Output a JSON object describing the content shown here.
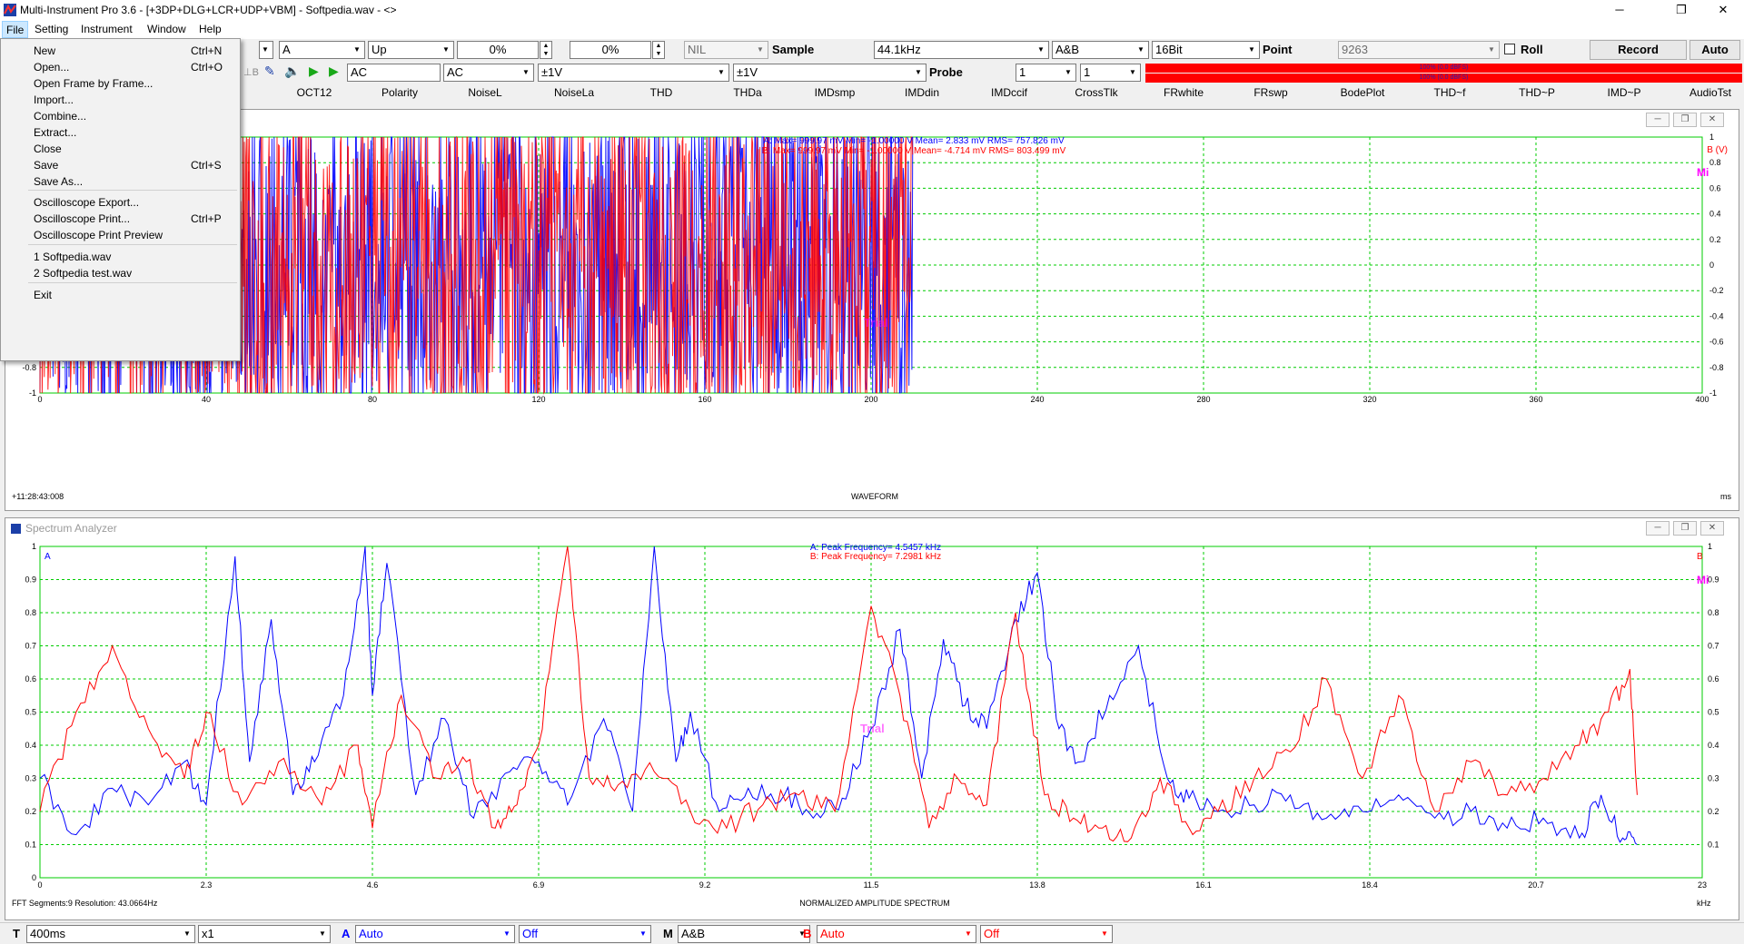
{
  "window": {
    "title": "Multi-Instrument Pro 3.6  -  [+3DP+DLG+LCR+UDP+VBM]  -  Softpedia.wav  -  <>"
  },
  "menubar": [
    "File",
    "Setting",
    "Instrument",
    "Window",
    "Help"
  ],
  "toolbar1": {
    "c1": "A",
    "c2": "Up",
    "trig_pct1": "0%",
    "trig_pct2": "0%",
    "nil": "NIL",
    "sample_label": "Sample",
    "sample": "44.1kHz",
    "channels": "A&B",
    "bits": "16Bit",
    "point_label": "Point",
    "point": "9263",
    "roll": "Roll",
    "record": "Record",
    "auto": "Auto"
  },
  "toolbar2": {
    "coupling_a": "AC",
    "coupling_b": "AC",
    "range_a": "±1V",
    "range_b": "±1V",
    "probe_label": "Probe",
    "probe_a": "1",
    "probe_b": "1",
    "level1": "100% (0.0 dBFS)",
    "level2": "100% (0.0 dBFS)"
  },
  "tabs": [
    "OCT12",
    "Polarity",
    "NoiseL",
    "NoiseLa",
    "THD",
    "THDa",
    "IMDsmp",
    "IMDdin",
    "IMDccif",
    "CrossTlk",
    "FRwhite",
    "FRswp",
    "BodePlot",
    "THD~f",
    "THD~P",
    "IMD~P",
    "AudioTst"
  ],
  "filemenu": {
    "items": [
      {
        "label": "New",
        "key": "Ctrl+N"
      },
      {
        "label": "Open...",
        "key": "Ctrl+O"
      },
      {
        "label": "Open Frame by Frame...",
        "key": ""
      },
      {
        "label": "Import...",
        "key": ""
      },
      {
        "label": "Combine...",
        "key": ""
      },
      {
        "label": "Extract...",
        "key": ""
      },
      {
        "label": "Close",
        "key": ""
      },
      {
        "label": "Save",
        "key": "Ctrl+S"
      },
      {
        "label": "Save As...",
        "key": ""
      },
      {
        "label": "Oscilloscope Export...",
        "key": ""
      },
      {
        "label": "Oscilloscope Print...",
        "key": "Ctrl+P"
      },
      {
        "label": "Oscilloscope Print Preview",
        "key": ""
      },
      {
        "label": "1 Softpedia.wav",
        "key": ""
      },
      {
        "label": "2 Softpedia test.wav",
        "key": ""
      },
      {
        "label": "Exit",
        "key": ""
      }
    ]
  },
  "oscilloscope": {
    "stats_a": "A: Max=   999.97 mV  Min= -1.00000   V  Mean=      2.833 mV  RMS=   757.826 mV",
    "stats_b": "B: Max=   999.97 mV  Min= -1.00000   V  Mean=     -4.714 mV  RMS=   803.499 mV",
    "right_unit": "B (V)",
    "timestamp": "+11:28:43:008",
    "xlabel": "WAVEFORM",
    "xunit": "ms",
    "badge": "Mi",
    "trial": "Trial"
  },
  "spectrum": {
    "title": "Spectrum Analyzer",
    "peak_a": "A: Peak Frequency=   4.5457  kHz",
    "peak_b": "B: Peak Frequency=   7.2981  kHz",
    "left_unit": "A",
    "right_unit": "B",
    "xlabel": "NORMALIZED AMPLITUDE SPECTRUM",
    "xunit": "kHz",
    "fft_info": "FFT Segments:9     Resolution: 43.0664Hz",
    "badge": "Mi",
    "trial": "Trial"
  },
  "bottombar": {
    "t_label": "T",
    "t_val": "400ms",
    "x_val": "x1",
    "a_label": "A",
    "a_val": "Auto",
    "a_off": "Off",
    "m_label": "M",
    "m_val": "A&B",
    "b_label": "B",
    "b_val": "Auto",
    "b_off": "Off"
  },
  "colors": {
    "channel_a": "#0000ff",
    "channel_b": "#ff0000",
    "grid": "#00cc00",
    "trial": "#ff00ff"
  },
  "chart_data": [
    {
      "type": "line",
      "title": "WAVEFORM",
      "xlabel": "ms",
      "ylabel": "B (V)",
      "xlim": [
        0,
        400
      ],
      "ylim": [
        -1,
        1
      ],
      "x_ticks": [
        0,
        40,
        80,
        120,
        160,
        200,
        240,
        280,
        320,
        360,
        400
      ],
      "y_ticks": [
        -1,
        -0.8,
        -0.6,
        -0.4,
        -0.2,
        0,
        0.2,
        0.4,
        0.6,
        0.8,
        1
      ],
      "series": [
        {
          "name": "A",
          "extent_ms": [
            0,
            210
          ]
        },
        {
          "name": "B",
          "extent_ms": [
            0,
            210
          ]
        }
      ]
    },
    {
      "type": "line",
      "title": "NORMALIZED AMPLITUDE SPECTRUM",
      "xlabel": "kHz",
      "xlim": [
        0,
        23
      ],
      "ylim": [
        0,
        1
      ],
      "x_ticks": [
        0,
        2.3,
        4.6,
        6.9,
        9.2,
        11.5,
        13.8,
        16.1,
        18.4,
        20.7,
        23
      ],
      "y_ticks": [
        0.1,
        0.2,
        0.3,
        0.4,
        0.5,
        0.6,
        0.7,
        0.8,
        0.9,
        1
      ],
      "series": [
        {
          "name": "A",
          "x": [
            0,
            0.5,
            1,
            1.5,
            2,
            2.3,
            2.7,
            2.9,
            3.2,
            3.5,
            3.8,
            4.2,
            4.5,
            4.6,
            4.8,
            5.2,
            5.6,
            6,
            6.5,
            6.9,
            7.3,
            7.8,
            8.2,
            8.5,
            8.8,
            9,
            9.4,
            9.8,
            10.3,
            10.7,
            11.1,
            11.5,
            11.9,
            12.2,
            12.5,
            12.8,
            13.1,
            13.5,
            13.8,
            14.1,
            14.4,
            14.8,
            15.2,
            15.6,
            15.9,
            16.3,
            16.8,
            17.3,
            17.8,
            18.3,
            18.8,
            19.3,
            19.8,
            20.3,
            20.8,
            21.3,
            21.6,
            21.9,
            22.1
          ],
          "values": [
            0.3,
            0.13,
            0.27,
            0.22,
            0.35,
            0.22,
            0.97,
            0.35,
            0.78,
            0.25,
            0.35,
            0.55,
            1.0,
            0.55,
            0.95,
            0.25,
            0.48,
            0.18,
            0.32,
            0.35,
            0.22,
            0.48,
            0.2,
            1.0,
            0.35,
            0.5,
            0.2,
            0.27,
            0.25,
            0.18,
            0.24,
            0.45,
            0.75,
            0.3,
            0.72,
            0.52,
            0.45,
            0.78,
            0.92,
            0.45,
            0.35,
            0.55,
            0.7,
            0.3,
            0.24,
            0.2,
            0.22,
            0.25,
            0.18,
            0.2,
            0.25,
            0.18,
            0.2,
            0.15,
            0.18,
            0.12,
            0.25,
            0.12,
            0.1
          ]
        },
        {
          "name": "B",
          "x": [
            0,
            0.5,
            1,
            1.5,
            2,
            2.3,
            2.8,
            3.3,
            3.9,
            4.4,
            4.6,
            5,
            5.5,
            5.9,
            6.3,
            6.6,
            6.9,
            7.3,
            7.6,
            8,
            8.5,
            9,
            9.5,
            10,
            10.5,
            11,
            11.5,
            11.9,
            12.3,
            12.7,
            13.1,
            13.5,
            13.9,
            14.3,
            14.7,
            15.1,
            15.5,
            15.9,
            16.3,
            16.8,
            17.3,
            17.8,
            18.3,
            18.8,
            19.3,
            19.8,
            20.3,
            20.8,
            21.3,
            21.7,
            22,
            22.1
          ],
          "values": [
            0.2,
            0.5,
            0.7,
            0.45,
            0.3,
            0.5,
            0.22,
            0.35,
            0.22,
            0.4,
            0.15,
            0.55,
            0.3,
            0.35,
            0.15,
            0.22,
            0.4,
            1.0,
            0.3,
            0.28,
            0.32,
            0.2,
            0.15,
            0.22,
            0.25,
            0.2,
            0.82,
            0.55,
            0.15,
            0.3,
            0.22,
            0.8,
            0.25,
            0.18,
            0.15,
            0.12,
            0.3,
            0.15,
            0.2,
            0.3,
            0.38,
            0.6,
            0.3,
            0.55,
            0.2,
            0.35,
            0.25,
            0.3,
            0.4,
            0.5,
            0.63,
            0.25
          ]
        }
      ]
    }
  ]
}
